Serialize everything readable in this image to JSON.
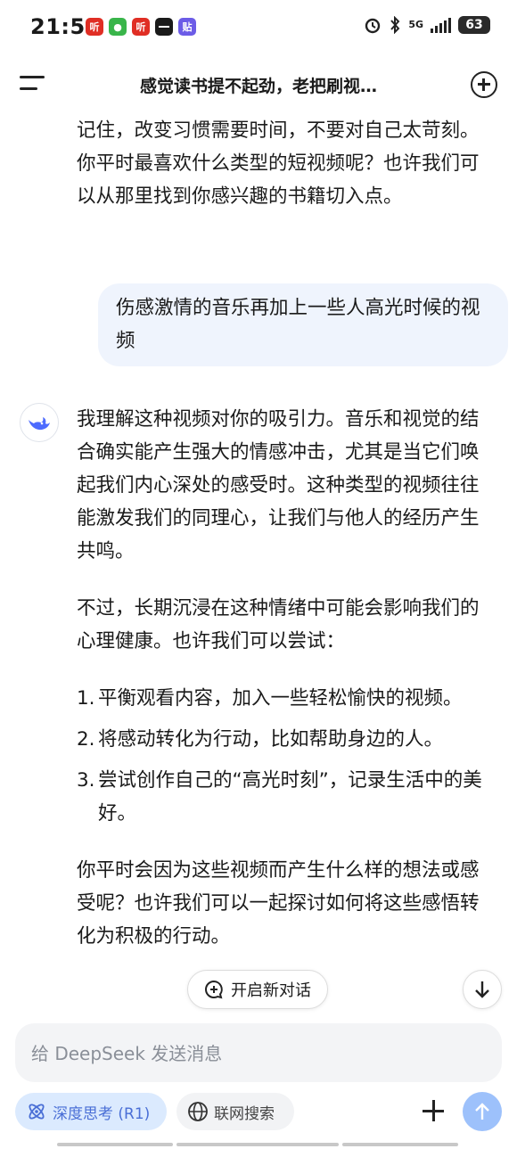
{
  "status_bar": {
    "time": "21:50",
    "app_icons": [
      {
        "name": "ting-app-icon",
        "label": "听",
        "color": "#e02e24"
      },
      {
        "name": "green-app-icon",
        "label": "●",
        "color": "#39b54a"
      },
      {
        "name": "ting-app-icon-2",
        "label": "听",
        "color": "#e02e24"
      },
      {
        "name": "weibo-app-icon",
        "label": "",
        "color": "#1a1a1a"
      },
      {
        "name": "tie-app-icon",
        "label": "贴",
        "color": "#6c5ce7"
      }
    ],
    "network": "5G",
    "battery": "63"
  },
  "header": {
    "title": "感觉读书提不起劲，老把刷视…"
  },
  "conversation": {
    "previous_ai_text": "记住，改变习惯需要时间，不要对自己太苛刻。你平时最喜欢什么类型的短视频呢？也许我们可以从那里找到你感兴趣的书籍切入点。",
    "user_message": "伤感激情的音乐再加上一些人高光时候的视频",
    "ai_reply": {
      "paragraph1": "我理解这种视频对你的吸引力。音乐和视觉的结合确实能产生强大的情感冲击，尤其是当它们唤起我们内心深处的感受时。这种类型的视频往往能激发我们的同理心，让我们与他人的经历产生共鸣。",
      "paragraph2": "不过，长期沉浸在这种情绪中可能会影响我们的心理健康。也许我们可以尝试：",
      "list": [
        {
          "num": "1.",
          "text": "平衡观看内容，加入一些轻松愉快的视频。"
        },
        {
          "num": "2.",
          "text": "将感动转化为行动，比如帮助身边的人。"
        },
        {
          "num": "3.",
          "text": "尝试创作自己的“高光时刻”，记录生活中的美好。"
        }
      ],
      "paragraph3": "你平时会因为这些视频而产生什么样的想法或感受呢？也许我们可以一起探讨如何将这些感悟转化为积极的行动。"
    }
  },
  "actions": {
    "new_dialog_label": "开启新对话"
  },
  "composer": {
    "placeholder": "给 DeepSeek 发送消息",
    "deep_think_label": "深度思考 (R1)",
    "web_search_label": "联网搜索"
  },
  "colors": {
    "accent": "#4d6bfe",
    "user_bubble": "#eff4fd",
    "send_button": "#9dc1fb",
    "deep_think_chip": "#dbeafe"
  }
}
